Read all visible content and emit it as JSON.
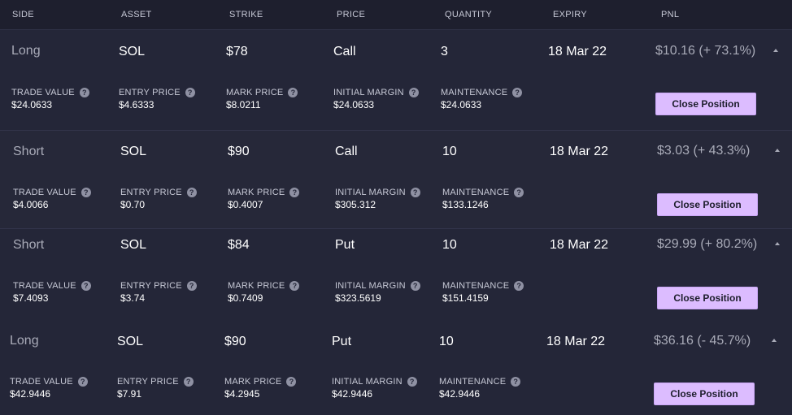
{
  "header": {
    "side": "SIDE",
    "asset": "ASSET",
    "strike": "STRIKE",
    "price": "PRICE",
    "quantity": "QUANTITY",
    "expiry": "EXPIRY",
    "pnl": "PNL"
  },
  "labels": {
    "trade_value": "TRADE VALUE",
    "entry_price": "ENTRY PRICE",
    "mark_price": "MARK PRICE",
    "initial_margin": "INITIAL MARGIN",
    "maintenance": "MAINTENANCE",
    "help_glyph": "?",
    "close_position": "Close Position"
  },
  "positions": [
    {
      "side": "Long",
      "asset": "SOL",
      "strike": "$78",
      "price": "Call",
      "quantity": "3",
      "expiry": "18 Mar 22",
      "pnl": "$10.16 (+ 73.1%)",
      "trade_value": "$24.0633",
      "entry_price": "$4.6333",
      "mark_price": "$8.0211",
      "initial_margin": "$24.0633",
      "maintenance": "$24.0633"
    },
    {
      "side": "Short",
      "asset": "SOL",
      "strike": "$90",
      "price": "Call",
      "quantity": "10",
      "expiry": "18 Mar 22",
      "pnl": "$3.03 (+ 43.3%)",
      "trade_value": "$4.0066",
      "entry_price": "$0.70",
      "mark_price": "$0.4007",
      "initial_margin": "$305.312",
      "maintenance": "$133.1246"
    },
    {
      "side": "Short",
      "asset": "SOL",
      "strike": "$84",
      "price": "Put",
      "quantity": "10",
      "expiry": "18 Mar 22",
      "pnl": "$29.99 (+ 80.2%)",
      "trade_value": "$7.4093",
      "entry_price": "$3.74",
      "mark_price": "$0.7409",
      "initial_margin": "$323.5619",
      "maintenance": "$151.4159"
    },
    {
      "side": "Long",
      "asset": "SOL",
      "strike": "$90",
      "price": "Put",
      "quantity": "10",
      "expiry": "18 Mar 22",
      "pnl": "$36.16 (- 45.7%)",
      "trade_value": "$42.9446",
      "entry_price": "$7.91",
      "mark_price": "$4.2945",
      "initial_margin": "$42.9446",
      "maintenance": "$42.9446"
    }
  ],
  "colors": {
    "background": "#242638",
    "header_bg": "#1e1f2e",
    "button_bg": "#dcbcff",
    "muted_text": "#a9abb8"
  },
  "icons": [
    "help-icon",
    "collapse-caret-icon"
  ]
}
